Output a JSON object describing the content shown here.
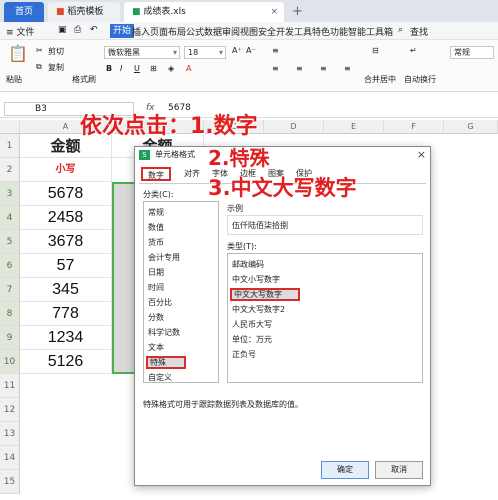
{
  "tabs": {
    "home": "首页",
    "template": "稻壳模板",
    "file": "成绩表.xls",
    "new_tab": "+"
  },
  "menu": {
    "file": "≡ 文件",
    "start": "开始",
    "items": [
      "插入",
      "页面布局",
      "公式",
      "数据",
      "审阅",
      "视图",
      "安全",
      "开发工具",
      "特色功能",
      "智能工具箱"
    ],
    "search": "查找"
  },
  "ribbon": {
    "paste": "粘贴",
    "cut": "剪切",
    "copy": "复制",
    "format_painter": "格式刷",
    "font_name": "微软雅黑",
    "font_size": "18",
    "merge_center": "合并居中",
    "auto_wrap": "自动换行",
    "number_format": "常规",
    "font_color_letter": "A"
  },
  "formula_bar": {
    "cell_ref": "B3",
    "fx": "fx",
    "value": "5678"
  },
  "grid": {
    "col_labels": [
      "A",
      "B",
      "C",
      "D",
      "E",
      "F",
      "G"
    ],
    "row_labels": [
      "1",
      "2",
      "3",
      "4",
      "5",
      "6",
      "7",
      "8",
      "9",
      "10",
      "11",
      "12",
      "13",
      "14",
      "15"
    ],
    "col_a_header": "金额",
    "col_b_header": "金额",
    "row2_text": "小写",
    "values": [
      "5678",
      "2458",
      "3678",
      "57",
      "345",
      "778",
      "1234",
      "5126"
    ]
  },
  "annotations": {
    "step1": "依次点击：1.数字",
    "step2": "2.特殊",
    "step3": "3.中文大写数字"
  },
  "dialog": {
    "title": "单元格格式",
    "close": "×",
    "tabs": [
      "数字",
      "对齐",
      "字体",
      "边框",
      "图案",
      "保护"
    ],
    "category_label": "分类(C):",
    "categories": [
      "常规",
      "数值",
      "货币",
      "会计专用",
      "日期",
      "时间",
      "百分比",
      "分数",
      "科学记数",
      "文本",
      "特殊",
      "自定义"
    ],
    "selected_category": "特殊",
    "sample_label": "示例",
    "sample_value": "伍仟陆佰柒拾捌",
    "type_label": "类型(T):",
    "types": [
      "邮政编码",
      "中文小写数字",
      "中文大写数字",
      "中文大写数字2",
      "人民币大写",
      "单位：万元",
      "正负号"
    ],
    "selected_type": "中文大写数字",
    "description": "特殊格式可用于跟踪数据列表及数据库的值。",
    "ok": "确定",
    "cancel": "取消"
  },
  "colors": {
    "accent": "#2f6fd6",
    "annotation_red": "#e02020",
    "selection_green": "#4caf50"
  }
}
